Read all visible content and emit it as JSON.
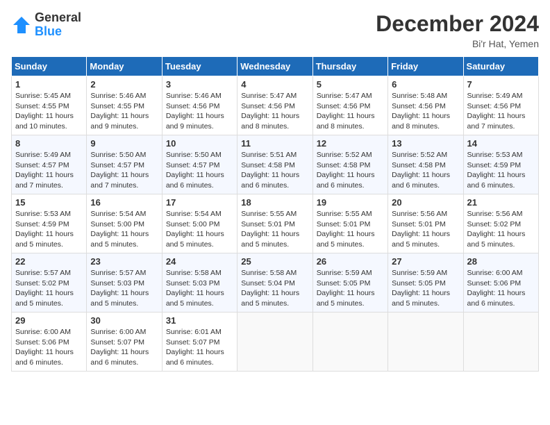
{
  "header": {
    "logo_general": "General",
    "logo_blue": "Blue",
    "month_title": "December 2024",
    "location": "Bi'r Hat, Yemen"
  },
  "days_of_week": [
    "Sunday",
    "Monday",
    "Tuesday",
    "Wednesday",
    "Thursday",
    "Friday",
    "Saturday"
  ],
  "weeks": [
    [
      {
        "day": "1",
        "sunrise": "5:45 AM",
        "sunset": "4:55 PM",
        "daylight": "11 hours and 10 minutes."
      },
      {
        "day": "2",
        "sunrise": "5:46 AM",
        "sunset": "4:55 PM",
        "daylight": "11 hours and 9 minutes."
      },
      {
        "day": "3",
        "sunrise": "5:46 AM",
        "sunset": "4:56 PM",
        "daylight": "11 hours and 9 minutes."
      },
      {
        "day": "4",
        "sunrise": "5:47 AM",
        "sunset": "4:56 PM",
        "daylight": "11 hours and 8 minutes."
      },
      {
        "day": "5",
        "sunrise": "5:47 AM",
        "sunset": "4:56 PM",
        "daylight": "11 hours and 8 minutes."
      },
      {
        "day": "6",
        "sunrise": "5:48 AM",
        "sunset": "4:56 PM",
        "daylight": "11 hours and 8 minutes."
      },
      {
        "day": "7",
        "sunrise": "5:49 AM",
        "sunset": "4:56 PM",
        "daylight": "11 hours and 7 minutes."
      }
    ],
    [
      {
        "day": "8",
        "sunrise": "5:49 AM",
        "sunset": "4:57 PM",
        "daylight": "11 hours and 7 minutes."
      },
      {
        "day": "9",
        "sunrise": "5:50 AM",
        "sunset": "4:57 PM",
        "daylight": "11 hours and 7 minutes."
      },
      {
        "day": "10",
        "sunrise": "5:50 AM",
        "sunset": "4:57 PM",
        "daylight": "11 hours and 6 minutes."
      },
      {
        "day": "11",
        "sunrise": "5:51 AM",
        "sunset": "4:58 PM",
        "daylight": "11 hours and 6 minutes."
      },
      {
        "day": "12",
        "sunrise": "5:52 AM",
        "sunset": "4:58 PM",
        "daylight": "11 hours and 6 minutes."
      },
      {
        "day": "13",
        "sunrise": "5:52 AM",
        "sunset": "4:58 PM",
        "daylight": "11 hours and 6 minutes."
      },
      {
        "day": "14",
        "sunrise": "5:53 AM",
        "sunset": "4:59 PM",
        "daylight": "11 hours and 6 minutes."
      }
    ],
    [
      {
        "day": "15",
        "sunrise": "5:53 AM",
        "sunset": "4:59 PM",
        "daylight": "11 hours and 5 minutes."
      },
      {
        "day": "16",
        "sunrise": "5:54 AM",
        "sunset": "5:00 PM",
        "daylight": "11 hours and 5 minutes."
      },
      {
        "day": "17",
        "sunrise": "5:54 AM",
        "sunset": "5:00 PM",
        "daylight": "11 hours and 5 minutes."
      },
      {
        "day": "18",
        "sunrise": "5:55 AM",
        "sunset": "5:01 PM",
        "daylight": "11 hours and 5 minutes."
      },
      {
        "day": "19",
        "sunrise": "5:55 AM",
        "sunset": "5:01 PM",
        "daylight": "11 hours and 5 minutes."
      },
      {
        "day": "20",
        "sunrise": "5:56 AM",
        "sunset": "5:01 PM",
        "daylight": "11 hours and 5 minutes."
      },
      {
        "day": "21",
        "sunrise": "5:56 AM",
        "sunset": "5:02 PM",
        "daylight": "11 hours and 5 minutes."
      }
    ],
    [
      {
        "day": "22",
        "sunrise": "5:57 AM",
        "sunset": "5:02 PM",
        "daylight": "11 hours and 5 minutes."
      },
      {
        "day": "23",
        "sunrise": "5:57 AM",
        "sunset": "5:03 PM",
        "daylight": "11 hours and 5 minutes."
      },
      {
        "day": "24",
        "sunrise": "5:58 AM",
        "sunset": "5:03 PM",
        "daylight": "11 hours and 5 minutes."
      },
      {
        "day": "25",
        "sunrise": "5:58 AM",
        "sunset": "5:04 PM",
        "daylight": "11 hours and 5 minutes."
      },
      {
        "day": "26",
        "sunrise": "5:59 AM",
        "sunset": "5:05 PM",
        "daylight": "11 hours and 5 minutes."
      },
      {
        "day": "27",
        "sunrise": "5:59 AM",
        "sunset": "5:05 PM",
        "daylight": "11 hours and 5 minutes."
      },
      {
        "day": "28",
        "sunrise": "6:00 AM",
        "sunset": "5:06 PM",
        "daylight": "11 hours and 6 minutes."
      }
    ],
    [
      {
        "day": "29",
        "sunrise": "6:00 AM",
        "sunset": "5:06 PM",
        "daylight": "11 hours and 6 minutes."
      },
      {
        "day": "30",
        "sunrise": "6:00 AM",
        "sunset": "5:07 PM",
        "daylight": "11 hours and 6 minutes."
      },
      {
        "day": "31",
        "sunrise": "6:01 AM",
        "sunset": "5:07 PM",
        "daylight": "11 hours and 6 minutes."
      },
      null,
      null,
      null,
      null
    ]
  ],
  "labels": {
    "sunrise": "Sunrise:",
    "sunset": "Sunset:",
    "daylight": "Daylight:"
  }
}
